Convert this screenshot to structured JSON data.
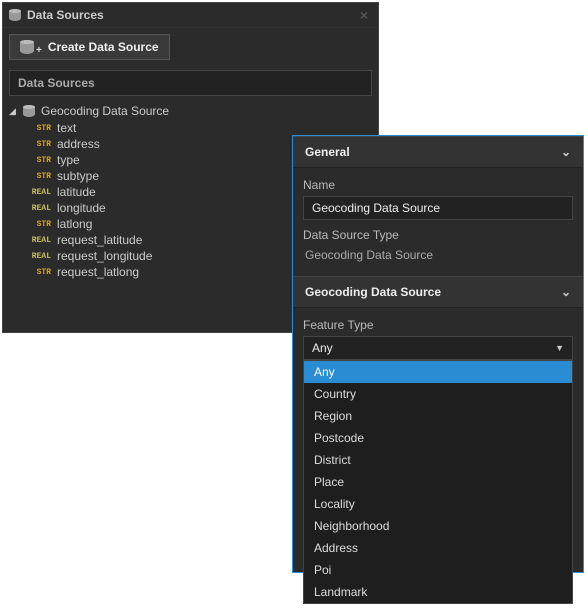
{
  "panel": {
    "title": "Data Sources",
    "create_label": "Create Data Source",
    "list_header": "Data Sources"
  },
  "tree": {
    "root_label": "Geocoding Data Source",
    "fields": [
      {
        "type": "STR",
        "name": "text"
      },
      {
        "type": "STR",
        "name": "address"
      },
      {
        "type": "STR",
        "name": "type"
      },
      {
        "type": "STR",
        "name": "subtype"
      },
      {
        "type": "REAL",
        "name": "latitude"
      },
      {
        "type": "REAL",
        "name": "longitude"
      },
      {
        "type": "STR",
        "name": "latlong"
      },
      {
        "type": "REAL",
        "name": "request_latitude"
      },
      {
        "type": "REAL",
        "name": "request_longitude"
      },
      {
        "type": "STR",
        "name": "request_latlong"
      }
    ]
  },
  "props": {
    "general_header": "General",
    "name_label": "Name",
    "name_value": "Geocoding Data Source",
    "type_label": "Data Source Type",
    "type_value": "Geocoding Data Source",
    "geo_header": "Geocoding Data Source",
    "feature_type_label": "Feature Type",
    "feature_type_selected": "Any",
    "feature_type_options": [
      "Any",
      "Country",
      "Region",
      "Postcode",
      "District",
      "Place",
      "Locality",
      "Neighborhood",
      "Address",
      "Poi",
      "Landmark"
    ]
  }
}
